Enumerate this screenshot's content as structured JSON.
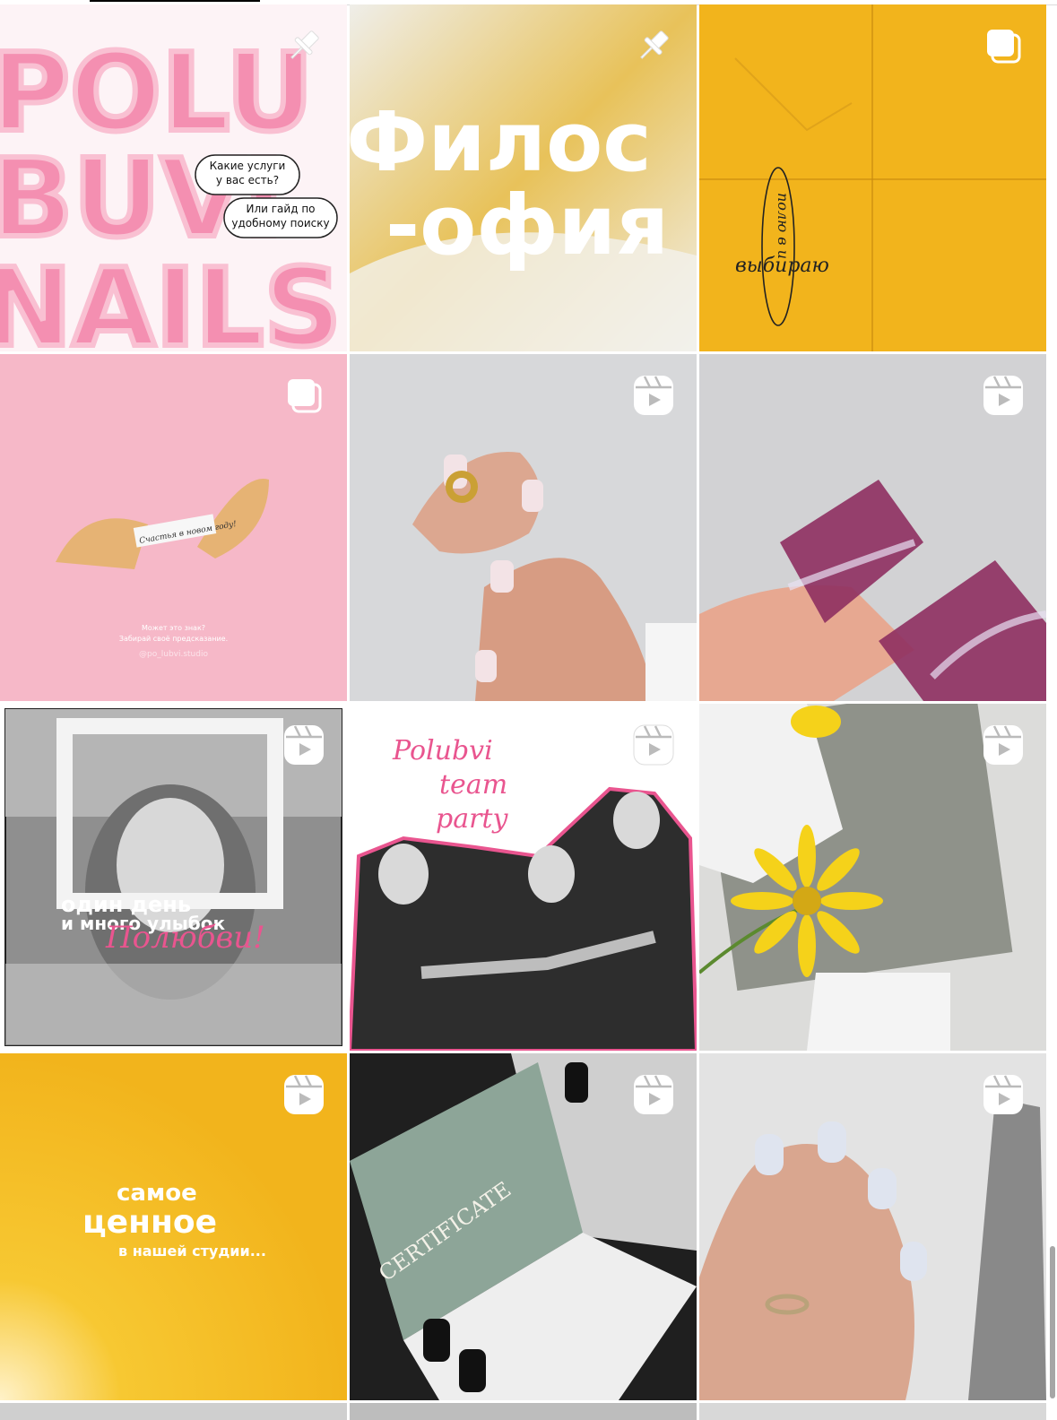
{
  "tabs": {
    "active_index": 0
  },
  "posts": [
    {
      "kind": "pinned",
      "title_lines": [
        "POLU",
        "BUVI",
        "NAILS"
      ],
      "bubbles": [
        "Какие услуги\nу вас есть?",
        "Или гайд по\nудобному поиску"
      ]
    },
    {
      "kind": "pinned",
      "title_lines": [
        "Филос",
        "-офия"
      ]
    },
    {
      "kind": "carousel",
      "note_vertical": "полю в и",
      "note_word": "выбираю"
    },
    {
      "kind": "carousel",
      "paper_text": "Счастья в новом году!",
      "caption": "Может это знак?\nЗабирай своё предсказание.",
      "handle": "@po_lubvi.studio"
    },
    {
      "kind": "reel"
    },
    {
      "kind": "reel"
    },
    {
      "kind": "reel",
      "line1": "один день",
      "line2": "и много улыбок",
      "script": "Полюбви!"
    },
    {
      "kind": "reel",
      "script_lines": [
        "Polubvi",
        "team",
        "party"
      ]
    },
    {
      "kind": "reel"
    },
    {
      "kind": "reel",
      "line1": "самое",
      "line2": "ценное",
      "line3": "в нашей студии..."
    },
    {
      "kind": "reel",
      "card_text": "CERTIFICATE"
    },
    {
      "kind": "reel"
    }
  ],
  "colors": {
    "pink_bg": "#f6b8c8",
    "bubble_pink": "#f48fb1",
    "yellow": "#f2b41c",
    "grey_bg": "#d9d9db",
    "accent_pink": "#e9558f"
  },
  "icons": {
    "pinned": "pin-icon",
    "carousel": "carousel-icon",
    "reel": "reels-icon"
  }
}
